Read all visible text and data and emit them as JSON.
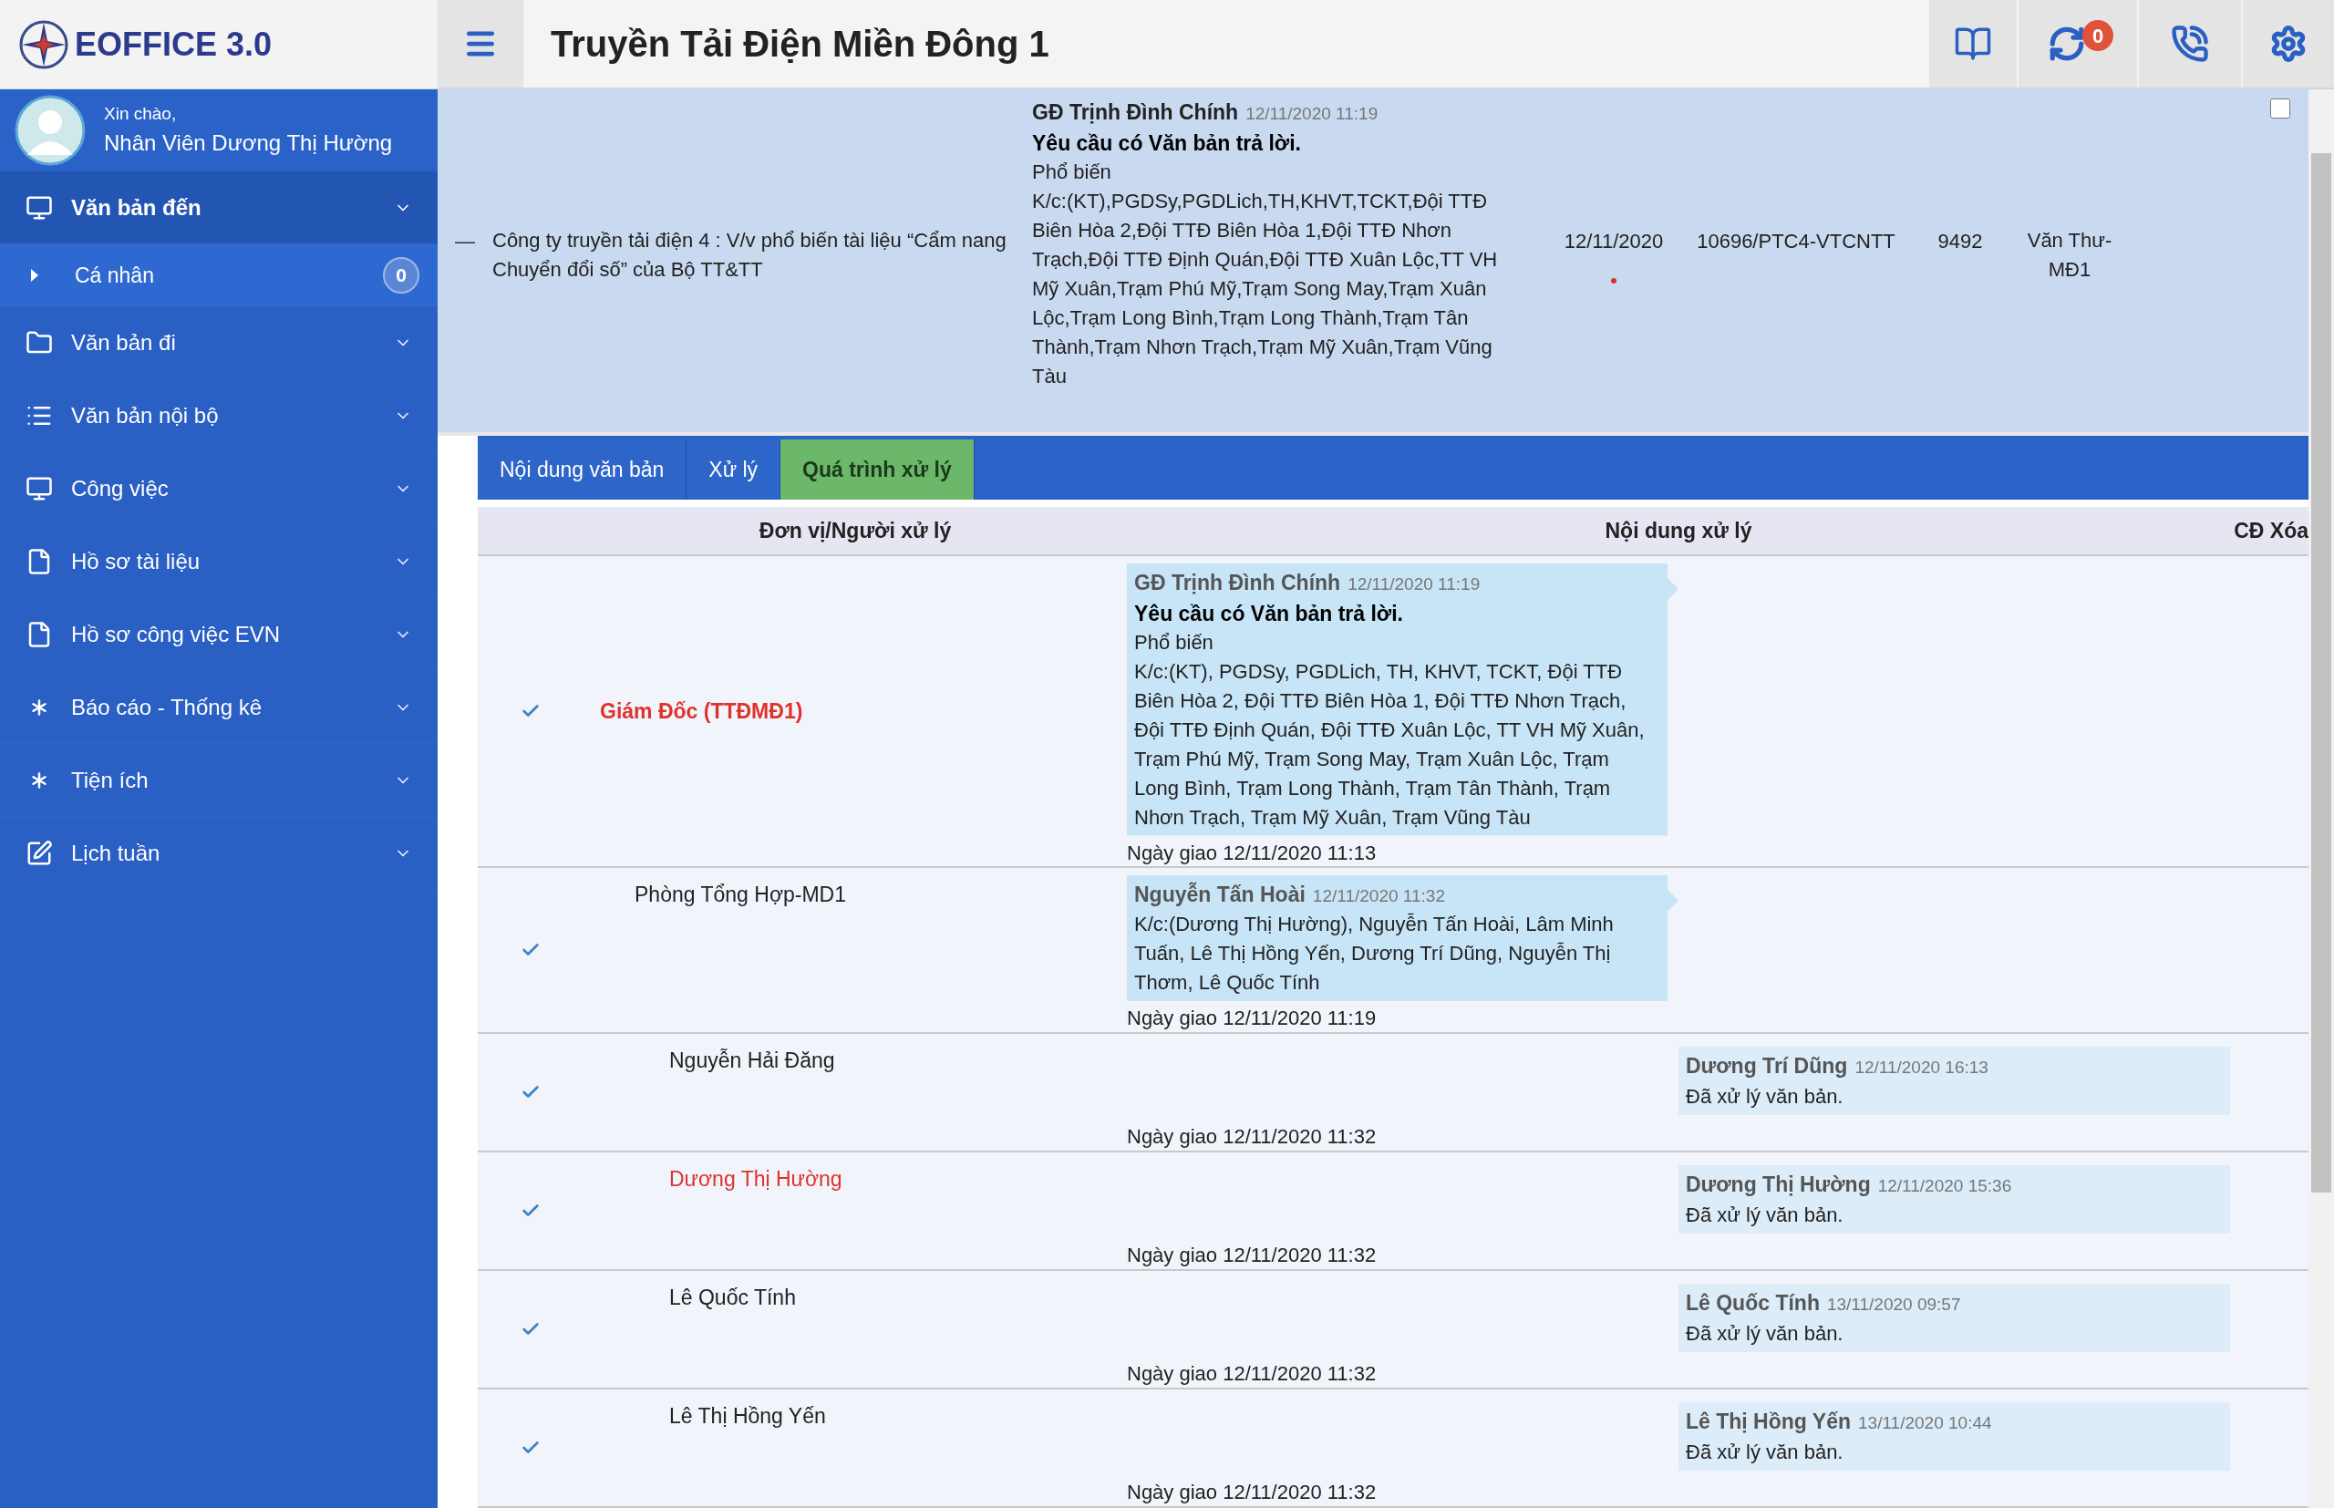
{
  "app": {
    "logo_text": "EOFFICE 3.0"
  },
  "user": {
    "greeting": "Xin chào,",
    "name": "Nhân Viên Dương Thị Hường"
  },
  "sidebar": {
    "items": [
      {
        "label": "Văn bản đến",
        "kind": "monitor",
        "expanded": true,
        "children": [
          {
            "label": "Cá nhân",
            "badge": "0"
          }
        ]
      },
      {
        "label": "Văn bản đi",
        "kind": "folder",
        "expanded": false
      },
      {
        "label": "Văn bản nội bộ",
        "kind": "list",
        "expanded": false
      },
      {
        "label": "Công việc",
        "kind": "monitor",
        "expanded": false
      },
      {
        "label": "Hồ sơ tài liệu",
        "kind": "file",
        "expanded": false
      },
      {
        "label": "Hồ sơ công việc EVN",
        "kind": "file",
        "expanded": false
      },
      {
        "label": "Báo cáo - Thống kê",
        "kind": "asterisk",
        "expanded": false
      },
      {
        "label": "Tiện ích",
        "kind": "asterisk",
        "expanded": false
      },
      {
        "label": "Lịch tuần",
        "kind": "edit",
        "expanded": false
      }
    ]
  },
  "header": {
    "title": "Truyền Tải Điện Miền Đông 1",
    "notification_count": "0"
  },
  "document_row": {
    "toggle": "—",
    "summary": "Công ty truyền tải điện 4 : V/v phổ biến tài liệu “Cẩm nang Chuyển đổi số” của Bộ TT&TT",
    "detail": {
      "author": "GĐ Trịnh Đình Chính",
      "time": "12/11/2020 11:19",
      "headline": "Yêu cầu có Văn bản trả lời.",
      "lines": [
        "Phổ biến",
        "K/c:(KT),PGDSy,PGDLich,TH,KHVT,TCKT,Đội TTĐ Biên Hòa 2,Đội TTĐ Biên Hòa 1,Đội TTĐ Nhơn Trạch,Đội TTĐ Định Quán,Đội TTĐ Xuân Lộc,TT VH Mỹ Xuân,Trạm Phú Mỹ,Trạm Song May,Trạm Xuân Lộc,Trạm Long Bình,Trạm Long Thành,Trạm Tân Thành,Trạm Nhơn Trạch,Trạm Mỹ Xuân,Trạm Vũng Tàu"
      ]
    },
    "date": "12/11/2020",
    "unread": true,
    "number": "10696/PTC4-VTCNTT",
    "code": "9492",
    "sender": "Văn Thư-MĐ1",
    "checked": false
  },
  "tabs": [
    {
      "label": "Nội dung văn bản",
      "selected": false
    },
    {
      "label": "Xử lý",
      "selected": false
    },
    {
      "label": "Quá trình xử lý",
      "selected": true
    }
  ],
  "process_table": {
    "columns": [
      "Đơn vị/Người xử lý",
      "Nội dung xử lý",
      "CĐ Xóa"
    ],
    "rows": [
      {
        "name": "Giám Đốc (TTĐMĐ1)",
        "highlighted": true,
        "done": true,
        "assigned": "Ngày giao 12/11/2020 11:13",
        "comment": {
          "kind": "forward",
          "author": "GĐ Trịnh Đình Chính",
          "time": "12/11/2020 11:19",
          "headline": "Yêu cầu có Văn bản trả lời.",
          "lines": [
            "Phổ biến",
            "K/c:(KT), PGDSy, PGDLich, TH, KHVT, TCKT, Đội TTĐ Biên Hòa 2, Đội TTĐ Biên Hòa 1, Đội TTĐ Nhơn Trạch, Đội TTĐ Định Quán, Đội TTĐ Xuân Lộc, TT VH Mỹ Xuân, Trạm Phú Mỹ, Trạm Song May, Trạm Xuân Lộc, Trạm Long Bình, Trạm Long Thành, Trạm Tân Thành, Trạm Nhơn Trạch, Trạm Mỹ Xuân, Trạm Vũng Tàu"
          ]
        },
        "children": [
          {
            "name": "Phòng Tổng Hợp-MD1",
            "highlighted": false,
            "done": true,
            "assigned": "Ngày giao 12/11/2020 11:19",
            "comment": {
              "kind": "forward",
              "author": "Nguyễn Tấn Hoài",
              "time": "12/11/2020 11:32",
              "lines": [
                "K/c:(Dương Thị Hường), Nguyễn Tấn Hoài, Lâm Minh Tuấn, Lê Thị Hồng Yến, Dương Trí Dũng, Nguyễn Thị Thơm, Lê Quốc Tính"
              ]
            },
            "children": [
              {
                "name": "Nguyễn Hải Đăng",
                "highlighted": false,
                "done": true,
                "assigned": "Ngày giao 12/11/2020 11:32",
                "comment": {
                  "kind": "done",
                  "author": "Dương Trí Dũng",
                  "time": "12/11/2020 16:13",
                  "lines": [
                    "Đã xử lý văn bản."
                  ]
                }
              },
              {
                "name": "Dương Thị Hường",
                "highlighted": true,
                "done": true,
                "assigned": "Ngày giao 12/11/2020 11:32",
                "comment": {
                  "kind": "done",
                  "author": "Dương Thị Hường",
                  "time": "12/11/2020 15:36",
                  "lines": [
                    "Đã xử lý văn bản."
                  ]
                }
              },
              {
                "name": "Lê Quốc Tính",
                "highlighted": false,
                "done": true,
                "assigned": "Ngày giao 12/11/2020 11:32",
                "comment": {
                  "kind": "done",
                  "author": "Lê Quốc Tính",
                  "time": "13/11/2020 09:57",
                  "lines": [
                    "Đã xử lý văn bản."
                  ]
                }
              },
              {
                "name": "Lê Thị Hồng Yến",
                "highlighted": false,
                "done": true,
                "assigned": "Ngày giao 12/11/2020 11:32",
                "comment": {
                  "kind": "done",
                  "author": "Lê Thị Hồng Yến",
                  "time": "13/11/2020 10:44",
                  "lines": [
                    "Đã xử lý văn bản."
                  ]
                }
              }
            ]
          }
        ]
      }
    ]
  }
}
